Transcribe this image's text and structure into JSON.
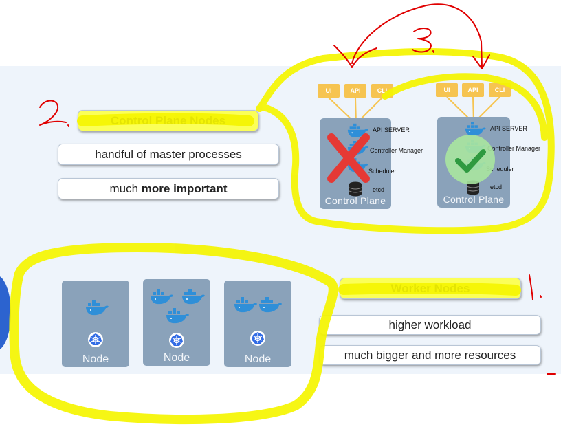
{
  "control_plane_section": {
    "title": "Control Plane Nodes",
    "point1": "handful of master processes",
    "point2_prefix": "much ",
    "point2_bold": "more important"
  },
  "worker_section": {
    "title": "Worker Nodes",
    "point1": "higher workload",
    "point2": "much bigger and more resources"
  },
  "control_plane_left": {
    "tags": [
      "UI",
      "API",
      "CLI"
    ],
    "components": [
      "API SERVER",
      "Controller Manager",
      "Scheduler",
      "etcd"
    ],
    "label": "Control Plane",
    "status": "rejected"
  },
  "control_plane_right": {
    "tags": [
      "UI",
      "API",
      "CLI"
    ],
    "components": [
      "API SERVER",
      "Controller Manager",
      "Scheduler",
      "etcd"
    ],
    "label": "Control Plane",
    "status": "approved"
  },
  "nodes": [
    {
      "label": "Node",
      "containers": 1
    },
    {
      "label": "Node",
      "containers": 3
    },
    {
      "label": "Node",
      "containers": 2
    }
  ],
  "annotations": {
    "num1": "1.",
    "num2": "2.",
    "num3": "3.",
    "highlight_color": "#f5f500",
    "ink_color": "#e00000"
  },
  "colors": {
    "panel": "#8aa2ba",
    "tag": "#f6c451",
    "docker": "#2f8fd8",
    "cross": "#e53935",
    "check_bg": "#a8e6a0",
    "check": "#2e9a40"
  }
}
